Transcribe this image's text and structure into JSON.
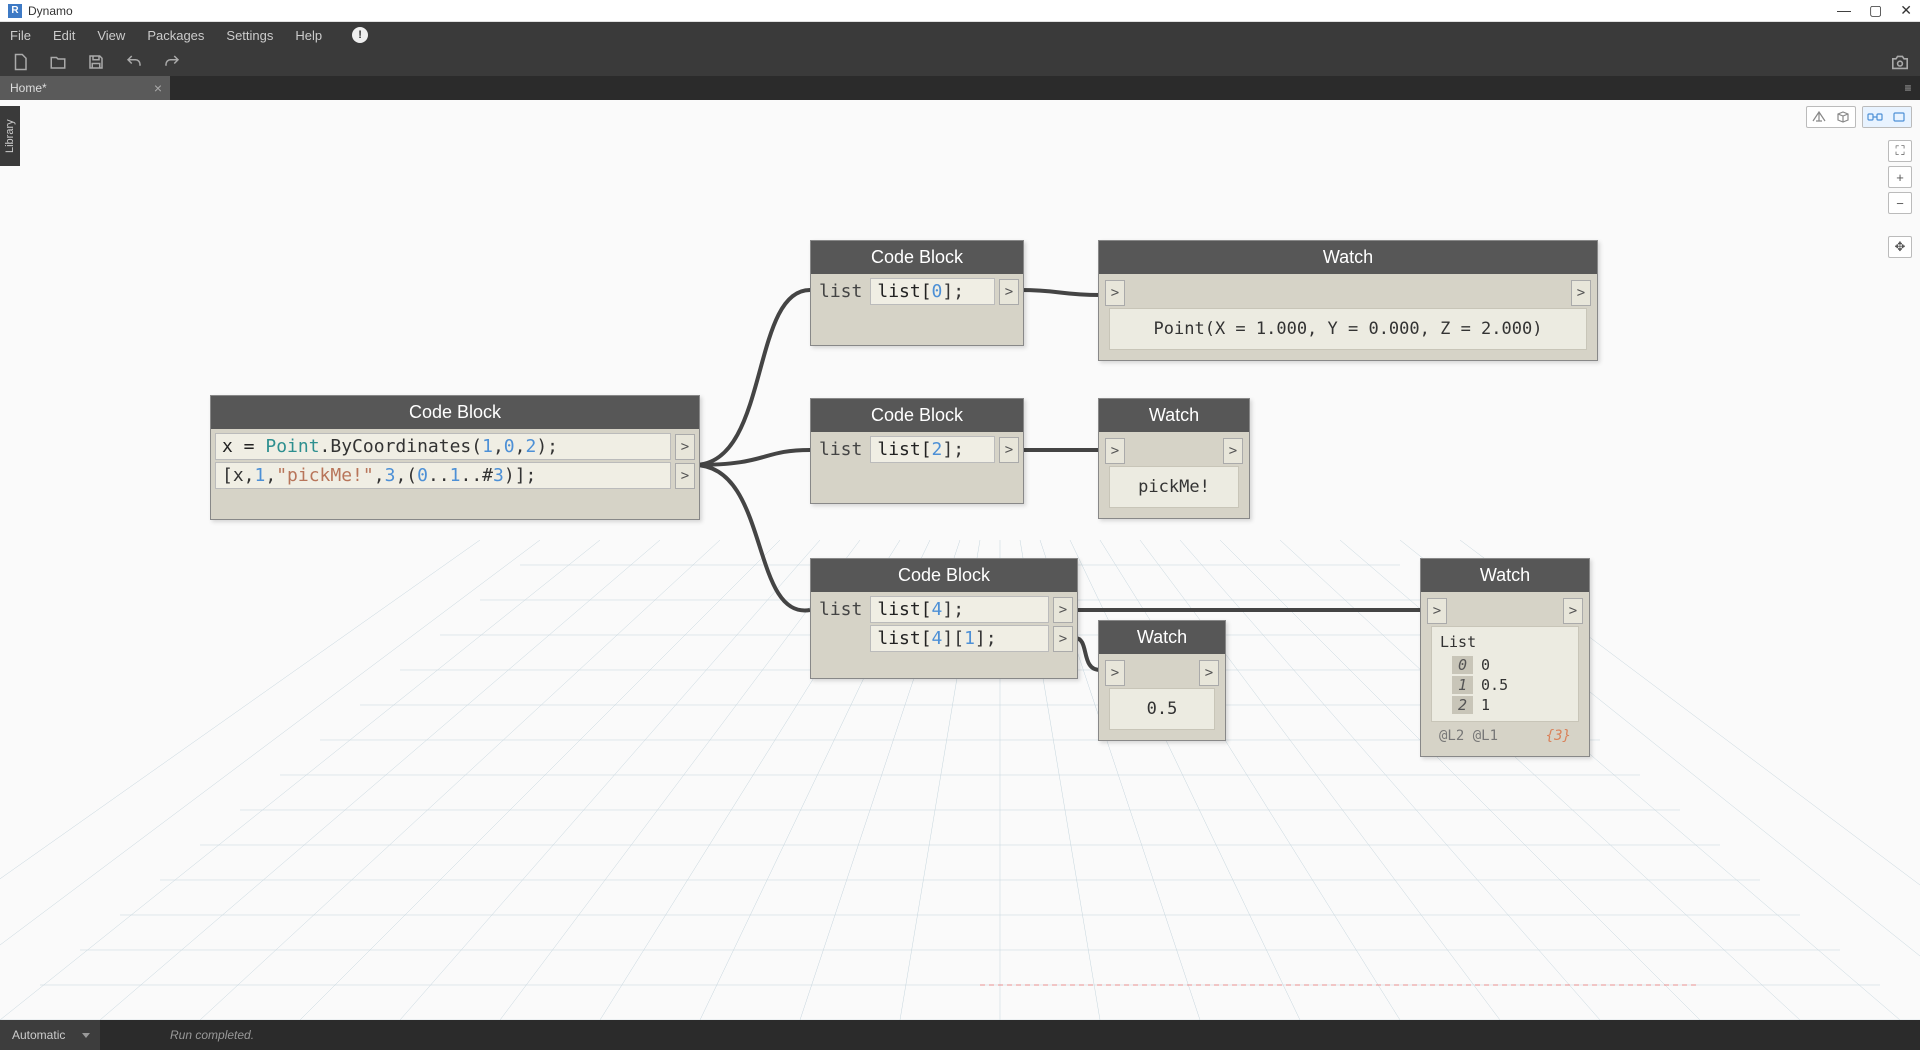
{
  "app": {
    "icon": "R",
    "title": "Dynamo"
  },
  "menu": {
    "items": [
      "File",
      "Edit",
      "View",
      "Packages",
      "Settings",
      "Help"
    ]
  },
  "tabs": {
    "active": "Home*",
    "close": "×"
  },
  "library_tab": "Library",
  "zoom": {
    "fit": "⛶",
    "plus": "+",
    "minus": "−",
    "pan": "✥"
  },
  "nodes": {
    "cb_main": {
      "title": "Code Block",
      "line1": {
        "var": "x",
        "eq": " = ",
        "cls": "Point",
        "dot": ".ByCoordinates(",
        "n1": "1",
        "c1": ",",
        "n2": "0",
        "c2": ",",
        "n3": "2",
        "end": ");"
      },
      "line2": {
        "open": "[x,",
        "n1": "1",
        "c1": ",",
        "str": "\"pickMe!\"",
        "c2": ",",
        "n2": "3",
        "c3": ",(",
        "r1": "0",
        "dd1": "..",
        "r2": "1",
        "dd2": "..#",
        "r3": "3",
        "close": ")];"
      },
      "out": ">"
    },
    "cb_0": {
      "title": "Code Block",
      "in": "list",
      "code_pre": "list[",
      "idx": "0",
      "code_post": "];",
      "out": ">"
    },
    "cb_2": {
      "title": "Code Block",
      "in": "list",
      "code_pre": "list[",
      "idx": "2",
      "code_post": "];",
      "out": ">"
    },
    "cb_4": {
      "title": "Code Block",
      "in": "list",
      "l1_pre": "list[",
      "l1_idx": "4",
      "l1_post": "];",
      "l2_pre": "list[",
      "l2_idx1": "4",
      "l2_mid": "][",
      "l2_idx2": "1",
      "l2_post": "];",
      "out": ">"
    },
    "watch_point": {
      "title": "Watch",
      "content": "Point(X = 1.000, Y = 0.000, Z = 2.000)",
      "port": ">"
    },
    "watch_pick": {
      "title": "Watch",
      "content": "pickMe!",
      "port": ">"
    },
    "watch_half": {
      "title": "Watch",
      "content": "0.5",
      "port": ">"
    },
    "watch_list": {
      "title": "Watch",
      "port": ">",
      "list_label": "List",
      "items": [
        {
          "idx": "0",
          "val": "0"
        },
        {
          "idx": "1",
          "val": "0.5"
        },
        {
          "idx": "2",
          "val": "1"
        }
      ],
      "footer_left": "@L2 @L1",
      "footer_count": "{3}"
    }
  },
  "statusbar": {
    "mode": "Automatic",
    "message": "Run completed."
  }
}
